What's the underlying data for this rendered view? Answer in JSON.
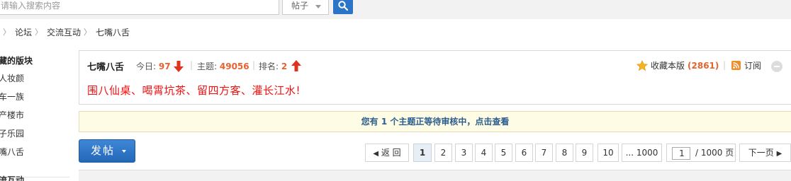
{
  "search": {
    "placeholder": "请输入搜索内容",
    "scope": "帖子"
  },
  "breadcrumb": [
    "论坛",
    "交流互动",
    "七嘴八舌"
  ],
  "sidebar": {
    "title": "藏的版块",
    "items": [
      "人妆颜",
      "车一族",
      "产楼市",
      "子乐园",
      "嘴八舌"
    ],
    "bottom_item": "流互动"
  },
  "forum": {
    "name": "七嘴八舌",
    "today_label": "今日:",
    "today_value": "97",
    "topics_label": "主题:",
    "topics_value": "49056",
    "rank_label": "排名:",
    "rank_value": "2",
    "slogan": "围八仙桌、喝霄坑茶、留四方客、灌长江水!",
    "favorite_label": "收藏本版",
    "favorite_count": "(2861)",
    "subscribe_label": "订阅"
  },
  "notice": "您有 1 个主题正等待审核中，点击查看",
  "post_button": "发帖",
  "pagination": {
    "prev": "返 回",
    "pages": [
      "1",
      "2",
      "3",
      "4",
      "5",
      "6",
      "7",
      "8",
      "9",
      "10"
    ],
    "current": "1",
    "last": "... 1000",
    "input_value": "1",
    "total": "/ 1000 页",
    "next": "下一页"
  },
  "colors": {
    "accent": "#2b74c7",
    "highlight": "#e5632e",
    "slogan": "#e11111",
    "notice_bg": "#fefce5",
    "notice_text": "#2b5d8f"
  }
}
